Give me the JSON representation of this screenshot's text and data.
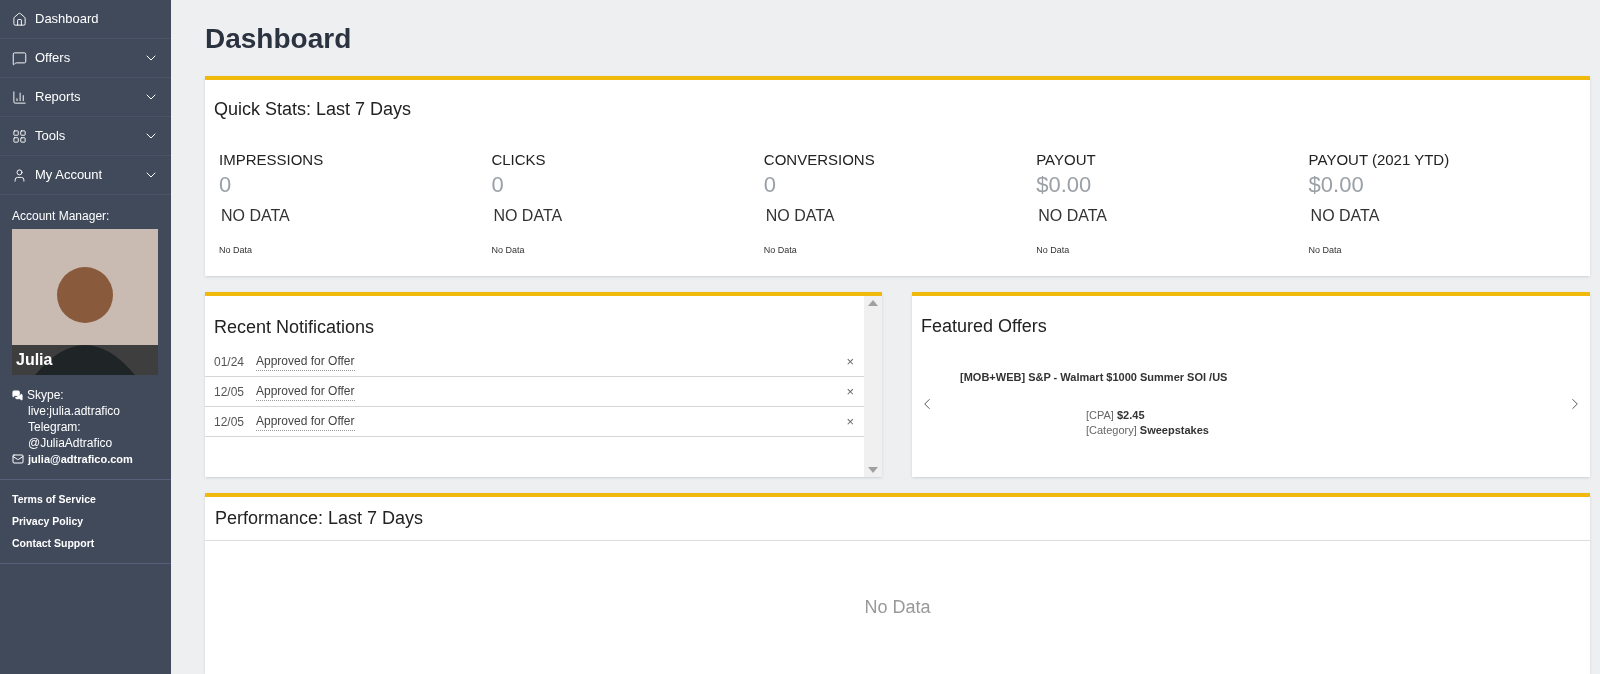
{
  "sidebar": {
    "items": [
      {
        "label": "Dashboard",
        "has_submenu": false
      },
      {
        "label": "Offers",
        "has_submenu": true
      },
      {
        "label": "Reports",
        "has_submenu": true
      },
      {
        "label": "Tools",
        "has_submenu": true
      },
      {
        "label": "My Account",
        "has_submenu": true
      }
    ],
    "account_manager": {
      "heading": "Account Manager:",
      "name": "Julia",
      "skype_label": "Skype:",
      "skype": "live:julia.adtrafico",
      "telegram_label": "Telegram:",
      "telegram": "@JuliaAdtrafico",
      "email": "julia@adtrafico.com"
    },
    "footer_links": [
      "Terms of Service",
      "Privacy Policy",
      "Contact Support"
    ]
  },
  "page_title": "Dashboard",
  "quick_stats": {
    "title": "Quick Stats: Last 7 Days",
    "stats": [
      {
        "label": "IMPRESSIONS",
        "value": "0",
        "status": "NO DATA",
        "note": "No Data"
      },
      {
        "label": "CLICKS",
        "value": "0",
        "status": "NO DATA",
        "note": "No Data"
      },
      {
        "label": "CONVERSIONS",
        "value": "0",
        "status": "NO DATA",
        "note": "No Data"
      },
      {
        "label": "PAYOUT",
        "value": "$0.00",
        "status": "NO DATA",
        "note": "No Data"
      },
      {
        "label": "PAYOUT (2021 YTD)",
        "value": "$0.00",
        "status": "NO DATA",
        "note": "No Data"
      }
    ]
  },
  "notifications": {
    "title": "Recent Notifications",
    "items": [
      {
        "date": "01/24",
        "text": "Approved for Offer",
        "close": "×"
      },
      {
        "date": "12/05",
        "text": "Approved for Offer",
        "close": "×"
      },
      {
        "date": "12/05",
        "text": "Approved for Offer",
        "close": "×"
      }
    ]
  },
  "featured_offers": {
    "title": "Featured Offers",
    "offer": {
      "name": "[MOB+WEB] S&P - Walmart $1000 Summer SOI /US",
      "payout_type": "[CPA]",
      "payout": "$2.45",
      "category_label": "[Category]",
      "category": "Sweepstakes"
    }
  },
  "performance": {
    "title": "Performance: Last 7 Days",
    "empty_text": "No Data"
  }
}
